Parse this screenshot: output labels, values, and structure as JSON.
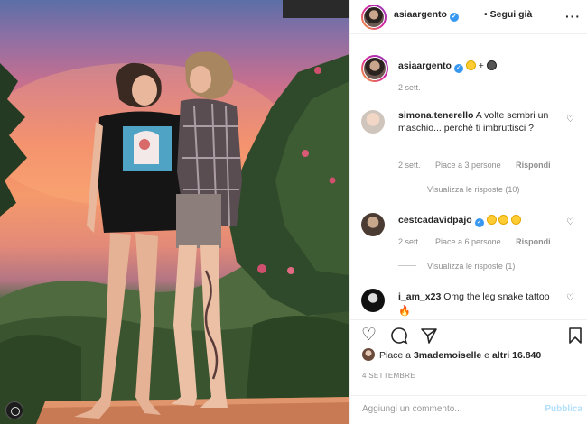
{
  "header": {
    "username": "asiaargento",
    "separator": "•",
    "follow_label": "Segui già",
    "more_icon": "more-dots-icon"
  },
  "caption": {
    "username": "asiaargento",
    "plus": "+",
    "time": "2 sett."
  },
  "comments": [
    {
      "username": "simona.tenerello",
      "text": "A volte sembri un maschio... perché ti imbruttisci ?",
      "time": "2 sett.",
      "likes": "Piace a 3 persone",
      "reply": "Rispondi",
      "replies": "Visualizza le risposte (10)"
    },
    {
      "username": "cestcadavidpajo",
      "text": "",
      "time": "2 sett.",
      "likes": "Piace a 6 persone",
      "reply": "Rispondi",
      "replies": "Visualizza le risposte (1)"
    },
    {
      "username": "i_am_x23",
      "text": "Omg the leg snake tattoo"
    }
  ],
  "actions": {
    "like_icon": "heart-icon",
    "comment_icon": "comment-icon",
    "share_icon": "paper-plane-icon",
    "save_icon": "bookmark-icon"
  },
  "likes": {
    "prefix": "Piace a",
    "user": "3mademoiselle",
    "middle": "e",
    "others": "altri 16.840"
  },
  "date": "4 SETTEMBRE",
  "add_comment": {
    "placeholder": "Aggiungi un commento...",
    "publish_label": "Pubblica"
  },
  "colors": {
    "verified": "#3897f0",
    "publish_disabled": "#b2dffc",
    "meta_text": "#8e8e8e"
  }
}
